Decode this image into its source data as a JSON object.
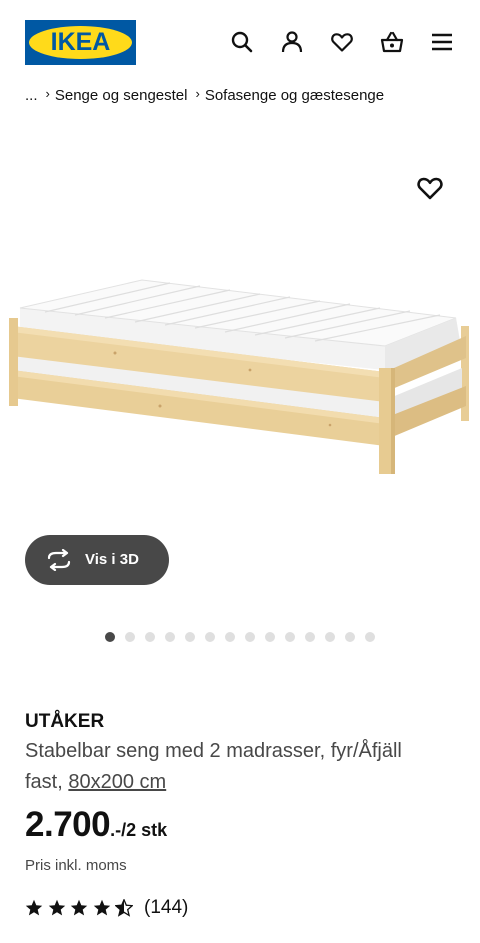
{
  "header": {
    "logo_text": "IKEA",
    "icons": [
      "search-icon",
      "user-icon",
      "heart-icon",
      "basket-icon",
      "menu-icon"
    ]
  },
  "breadcrumb": {
    "ellipsis": "...",
    "items": [
      "Senge og sengestel",
      "Sofasenge og gæstesenge"
    ]
  },
  "gallery": {
    "view_3d_label": "Vis i 3D",
    "dot_count": 14,
    "active_dot": 0
  },
  "product": {
    "name": "UTÅKER",
    "description": "Stabelbar seng med 2 madrasser, fyr/Åfjäll fast, ",
    "size_link": "80x200 cm",
    "price_main": "2.700",
    "price_suffix": ".-/2 stk",
    "price_note": "Pris inkl. moms",
    "rating": 4.5,
    "rating_max": 5,
    "review_count": "(144)"
  },
  "colors": {
    "brand_blue": "#0058a3",
    "brand_yellow": "#ffda1a",
    "button_dark": "#484848"
  }
}
